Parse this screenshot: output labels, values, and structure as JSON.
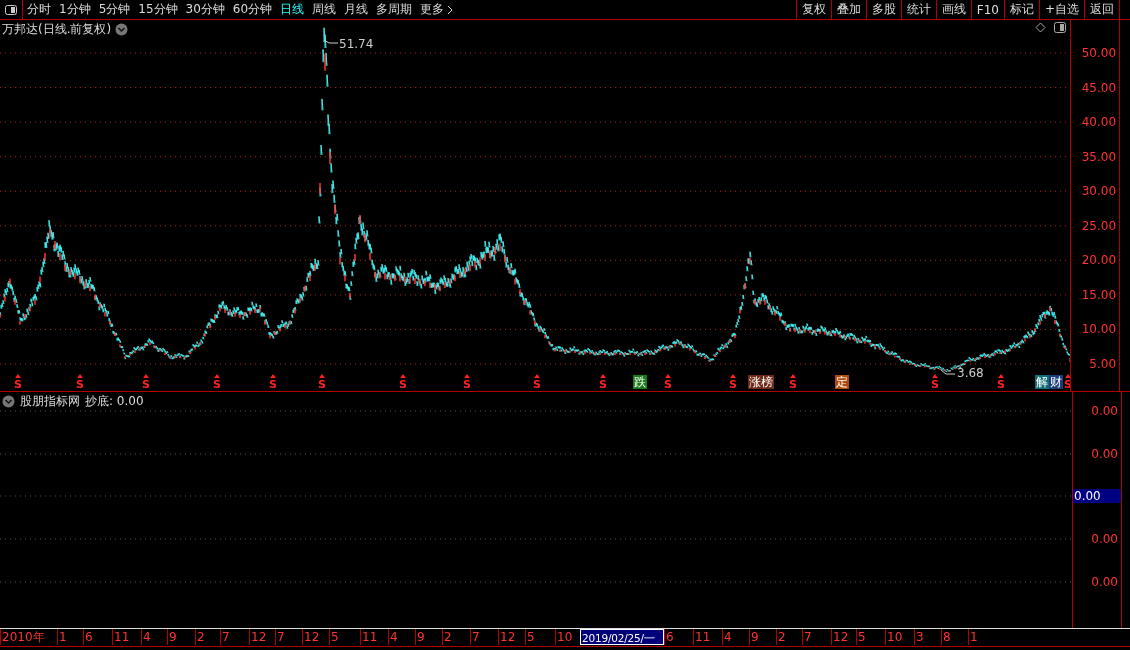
{
  "toolbar": {
    "periods": [
      {
        "label": "分时",
        "selected": false
      },
      {
        "label": "1分钟",
        "selected": false
      },
      {
        "label": "5分钟",
        "selected": false
      },
      {
        "label": "15分钟",
        "selected": false
      },
      {
        "label": "30分钟",
        "selected": false
      },
      {
        "label": "60分钟",
        "selected": false
      },
      {
        "label": "日线",
        "selected": true
      },
      {
        "label": "周线",
        "selected": false
      },
      {
        "label": "月线",
        "selected": false
      },
      {
        "label": "多周期",
        "selected": false
      },
      {
        "label": "更多",
        "selected": false
      }
    ],
    "buttons": [
      "复权",
      "叠加",
      "多股",
      "统计",
      "画线",
      "F10",
      "标记",
      "+自选",
      "返回"
    ]
  },
  "main_chart": {
    "title": "万邦达(日线.前复权)",
    "high_label": "51.74",
    "low_label": "3.68",
    "axis_labels": [
      "50.00",
      "45.00",
      "40.00",
      "35.00",
      "30.00",
      "25.00",
      "20.00",
      "15.00",
      "10.00",
      "5.00"
    ],
    "markers": [
      {
        "kind": "signal",
        "text": "S"
      },
      {
        "kind": "signal",
        "text": "S"
      },
      {
        "kind": "signal",
        "text": "S"
      },
      {
        "kind": "signal",
        "text": "S"
      },
      {
        "kind": "signal",
        "text": "S"
      },
      {
        "kind": "signal",
        "text": "S"
      },
      {
        "kind": "signal",
        "text": "S"
      },
      {
        "kind": "signal",
        "text": "S"
      },
      {
        "kind": "signal",
        "text": "S"
      },
      {
        "kind": "signal",
        "text": "S"
      },
      {
        "kind": "tag",
        "text": "跌",
        "color": "#1c7c1c"
      },
      {
        "kind": "signal",
        "text": "S"
      },
      {
        "kind": "signal",
        "text": "S"
      },
      {
        "kind": "tag",
        "text": "涨榜",
        "color": "#6e2a16"
      },
      {
        "kind": "signal",
        "text": "S"
      },
      {
        "kind": "tag",
        "text": "定",
        "color": "#b24a0e"
      },
      {
        "kind": "signal",
        "text": "S"
      },
      {
        "kind": "signal",
        "text": "S"
      },
      {
        "kind": "tag",
        "text": "解",
        "color": "#0e6e74"
      },
      {
        "kind": "tag",
        "text": "财",
        "color": "#1e3a7a"
      },
      {
        "kind": "signal",
        "text": "S"
      }
    ]
  },
  "indicator": {
    "name": "股朋指标网",
    "reading": "抄底: 0.00",
    "axis_labels": [
      {
        "text": "0.00",
        "selected": false
      },
      {
        "text": "0.00",
        "selected": false
      },
      {
        "text": "0.00",
        "selected": true
      },
      {
        "text": "0.00",
        "selected": false
      },
      {
        "text": "0.00",
        "selected": false
      }
    ]
  },
  "time_axis": [
    {
      "text": "2010年",
      "selected": false
    },
    {
      "text": "1",
      "selected": false
    },
    {
      "text": "6",
      "selected": false
    },
    {
      "text": "11",
      "selected": false
    },
    {
      "text": "4",
      "selected": false
    },
    {
      "text": "9",
      "selected": false
    },
    {
      "text": "2",
      "selected": false
    },
    {
      "text": "7",
      "selected": false
    },
    {
      "text": "12",
      "selected": false
    },
    {
      "text": "7",
      "selected": false
    },
    {
      "text": "12",
      "selected": false
    },
    {
      "text": "5",
      "selected": false
    },
    {
      "text": "11",
      "selected": false
    },
    {
      "text": "4",
      "selected": false
    },
    {
      "text": "9",
      "selected": false
    },
    {
      "text": "2",
      "selected": false
    },
    {
      "text": "7",
      "selected": false
    },
    {
      "text": "12",
      "selected": false
    },
    {
      "text": "5",
      "selected": false
    },
    {
      "text": "10",
      "selected": false
    },
    {
      "text": "2019/02/25/一",
      "selected": true
    },
    {
      "text": "6",
      "selected": false
    },
    {
      "text": "11",
      "selected": false
    },
    {
      "text": "4",
      "selected": false
    },
    {
      "text": "9",
      "selected": false
    },
    {
      "text": "2",
      "selected": false
    },
    {
      "text": "7",
      "selected": false
    },
    {
      "text": "12",
      "selected": false
    },
    {
      "text": "5",
      "selected": false
    },
    {
      "text": "10",
      "selected": false
    },
    {
      "text": "3",
      "selected": false
    },
    {
      "text": "8",
      "selected": false
    },
    {
      "text": "1",
      "selected": false
    }
  ]
}
